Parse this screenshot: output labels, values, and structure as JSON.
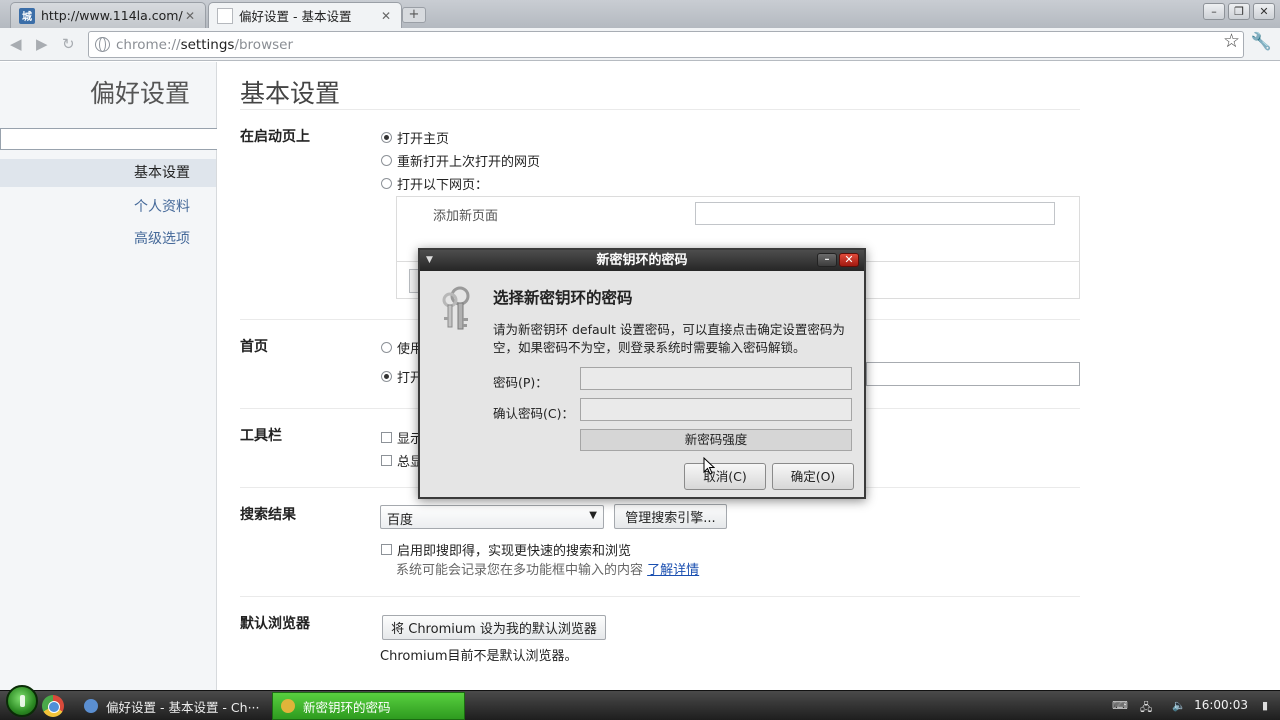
{
  "browser": {
    "tabs": [
      {
        "title": "http://www.114la.com/?···",
        "favicon_text": "城",
        "active": false
      },
      {
        "title": "偏好设置 - 基本设置",
        "active": true
      }
    ],
    "url_scheme": "chrome://",
    "url_host": "settings",
    "url_path": "/browser",
    "window_controls": {
      "minimize": "–",
      "maximize": "❐",
      "close": "✕"
    }
  },
  "sidebar": {
    "title": "偏好设置",
    "search_value": "",
    "items": [
      {
        "label": "基本设置",
        "selected": true
      },
      {
        "label": "个人资料",
        "selected": false
      },
      {
        "label": "高级选项",
        "selected": false
      }
    ]
  },
  "main": {
    "title": "基本设置",
    "startup": {
      "label": "在启动页上",
      "options": [
        "打开主页",
        "重新打开上次打开的网页",
        "打开以下网页："
      ],
      "selected_index": 0,
      "add_page_label": "添加新页面",
      "add_page_value": ""
    },
    "homepage": {
      "label": "首页",
      "option_new_tab": "使用",
      "option_open": "打开",
      "selected_index": 1,
      "url_value": ""
    },
    "toolbar": {
      "label": "工具栏",
      "option_show": "显示",
      "option_always": "总显"
    },
    "search": {
      "label": "搜索结果",
      "engine": "百度",
      "manage_button": "管理搜索引擎...",
      "instant_label": "启用即搜即得，实现更快速的搜索和浏览",
      "instant_hint": "系统可能会记录您在多功能框中输入的内容",
      "learn_more": "了解详情"
    },
    "default_browser": {
      "label": "默认浏览器",
      "button": "将 Chromium 设为我的默认浏览器",
      "status": "Chromium目前不是默认浏览器。"
    }
  },
  "dialog": {
    "title": "新密钥环的密码",
    "heading": "选择新密钥环的密码",
    "description": "请为新密钥环 default 设置密码，可以直接点击确定设置密码为空，如果密码不为空，则登录系统时需要输入密码解锁。",
    "password_label": "密码(P)：",
    "password_value": "",
    "confirm_label": "确认密码(C)：",
    "confirm_value": "",
    "strength_label": "新密码强度",
    "cancel_button": "取消(C)",
    "ok_button": "确定(O)"
  },
  "taskbar": {
    "tasks": [
      {
        "label": "偏好设置 - 基本设置 - Ch···",
        "active": false
      },
      {
        "label": "新密钥环的密码",
        "active": true
      }
    ],
    "clock": "16:00:03"
  },
  "colors": {
    "link": "#466a9a",
    "taskbar_active": "#3fb22c",
    "dialog_close": "#c8291c"
  }
}
